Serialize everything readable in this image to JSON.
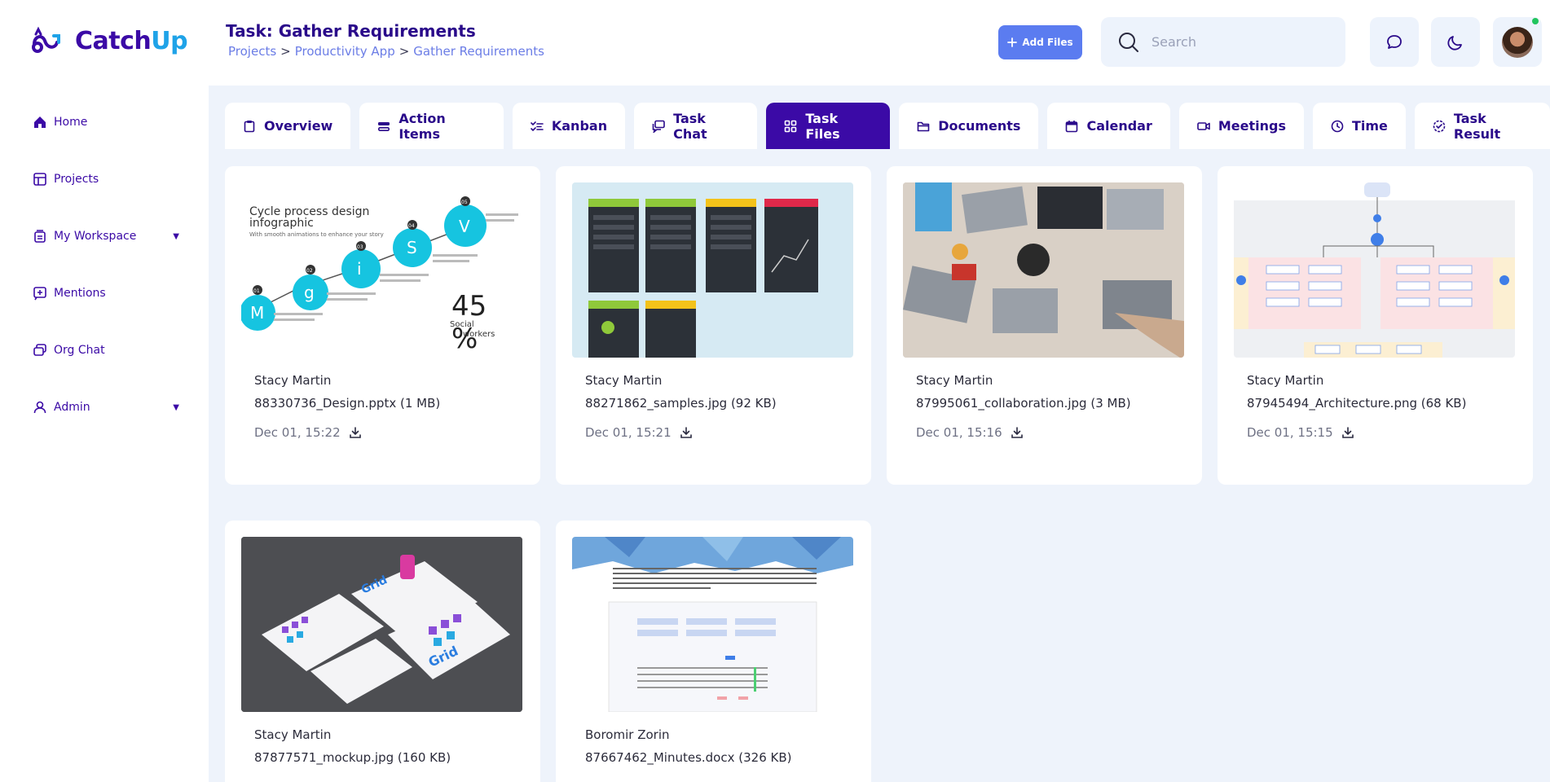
{
  "app": {
    "logo_main": "Catch",
    "logo_accent": "Up"
  },
  "header": {
    "task_title": "Task: Gather Requirements",
    "breadcrumb": [
      "Projects",
      "Productivity App",
      "Gather Requirements"
    ],
    "breadcrumb_sep": ">",
    "add_files_label": "Add Files",
    "search_placeholder": "Search"
  },
  "sidebar": {
    "items": [
      {
        "label": "Home",
        "icon": "home-icon"
      },
      {
        "label": "Projects",
        "icon": "projects-icon"
      },
      {
        "label": "My Workspace",
        "icon": "workspace-icon",
        "has_caret": true
      },
      {
        "label": "Mentions",
        "icon": "mentions-icon"
      },
      {
        "label": "Org Chat",
        "icon": "org-chat-icon"
      },
      {
        "label": "Admin",
        "icon": "user-icon",
        "has_caret": true
      }
    ]
  },
  "tabs": [
    {
      "label": "Overview",
      "icon": "clipboard-icon"
    },
    {
      "label": "Action Items",
      "icon": "action-items-icon"
    },
    {
      "label": "Kanban",
      "icon": "checklist-icon"
    },
    {
      "label": "Task Chat",
      "icon": "chat-icon"
    },
    {
      "label": "Task Files",
      "icon": "grid-icon",
      "active": true
    },
    {
      "label": "Documents",
      "icon": "folder-icon"
    },
    {
      "label": "Calendar",
      "icon": "calendar-icon"
    },
    {
      "label": "Meetings",
      "icon": "video-icon"
    },
    {
      "label": "Time",
      "icon": "clock-icon"
    },
    {
      "label": "Task Result",
      "icon": "check-circle-icon"
    }
  ],
  "files": [
    {
      "uploader": "Stacy Martin",
      "name": "88330736_Design.pptx (1 MB)",
      "date": "Dec 01, 15:22"
    },
    {
      "uploader": "Stacy Martin",
      "name": "88271862_samples.jpg (92 KB)",
      "date": "Dec 01, 15:21"
    },
    {
      "uploader": "Stacy Martin",
      "name": "87995061_collaboration.jpg (3 MB)",
      "date": "Dec 01, 15:16"
    },
    {
      "uploader": "Stacy Martin",
      "name": "87945494_Architecture.png (68 KB)",
      "date": "Dec 01, 15:15"
    },
    {
      "uploader": "Stacy Martin",
      "name": "87877571_mockup.jpg (160 KB)",
      "date": ""
    },
    {
      "uploader": "Boromir Zorin",
      "name": "87667462_Minutes.docx (326 KB)",
      "date": ""
    }
  ],
  "thumb_text": {
    "infographic_title": "Cycle process design",
    "infographic_title2": "infographic",
    "infographic_sub": "With smooth animations to enhance your story",
    "infographic_letters": [
      "M",
      "g",
      "i",
      "S",
      "V"
    ],
    "infographic_nums": [
      "01",
      "02",
      "03",
      "04",
      "05"
    ],
    "infographic_big": "45",
    "infographic_pct": "%",
    "infographic_social": "Social",
    "infographic_workers": "workers",
    "mockup_brand": "Grid"
  },
  "colors": {
    "primary": "#3b0aa6",
    "accent": "#1fa3e8",
    "button": "#5b7cf0",
    "bg": "#eef3fb"
  }
}
